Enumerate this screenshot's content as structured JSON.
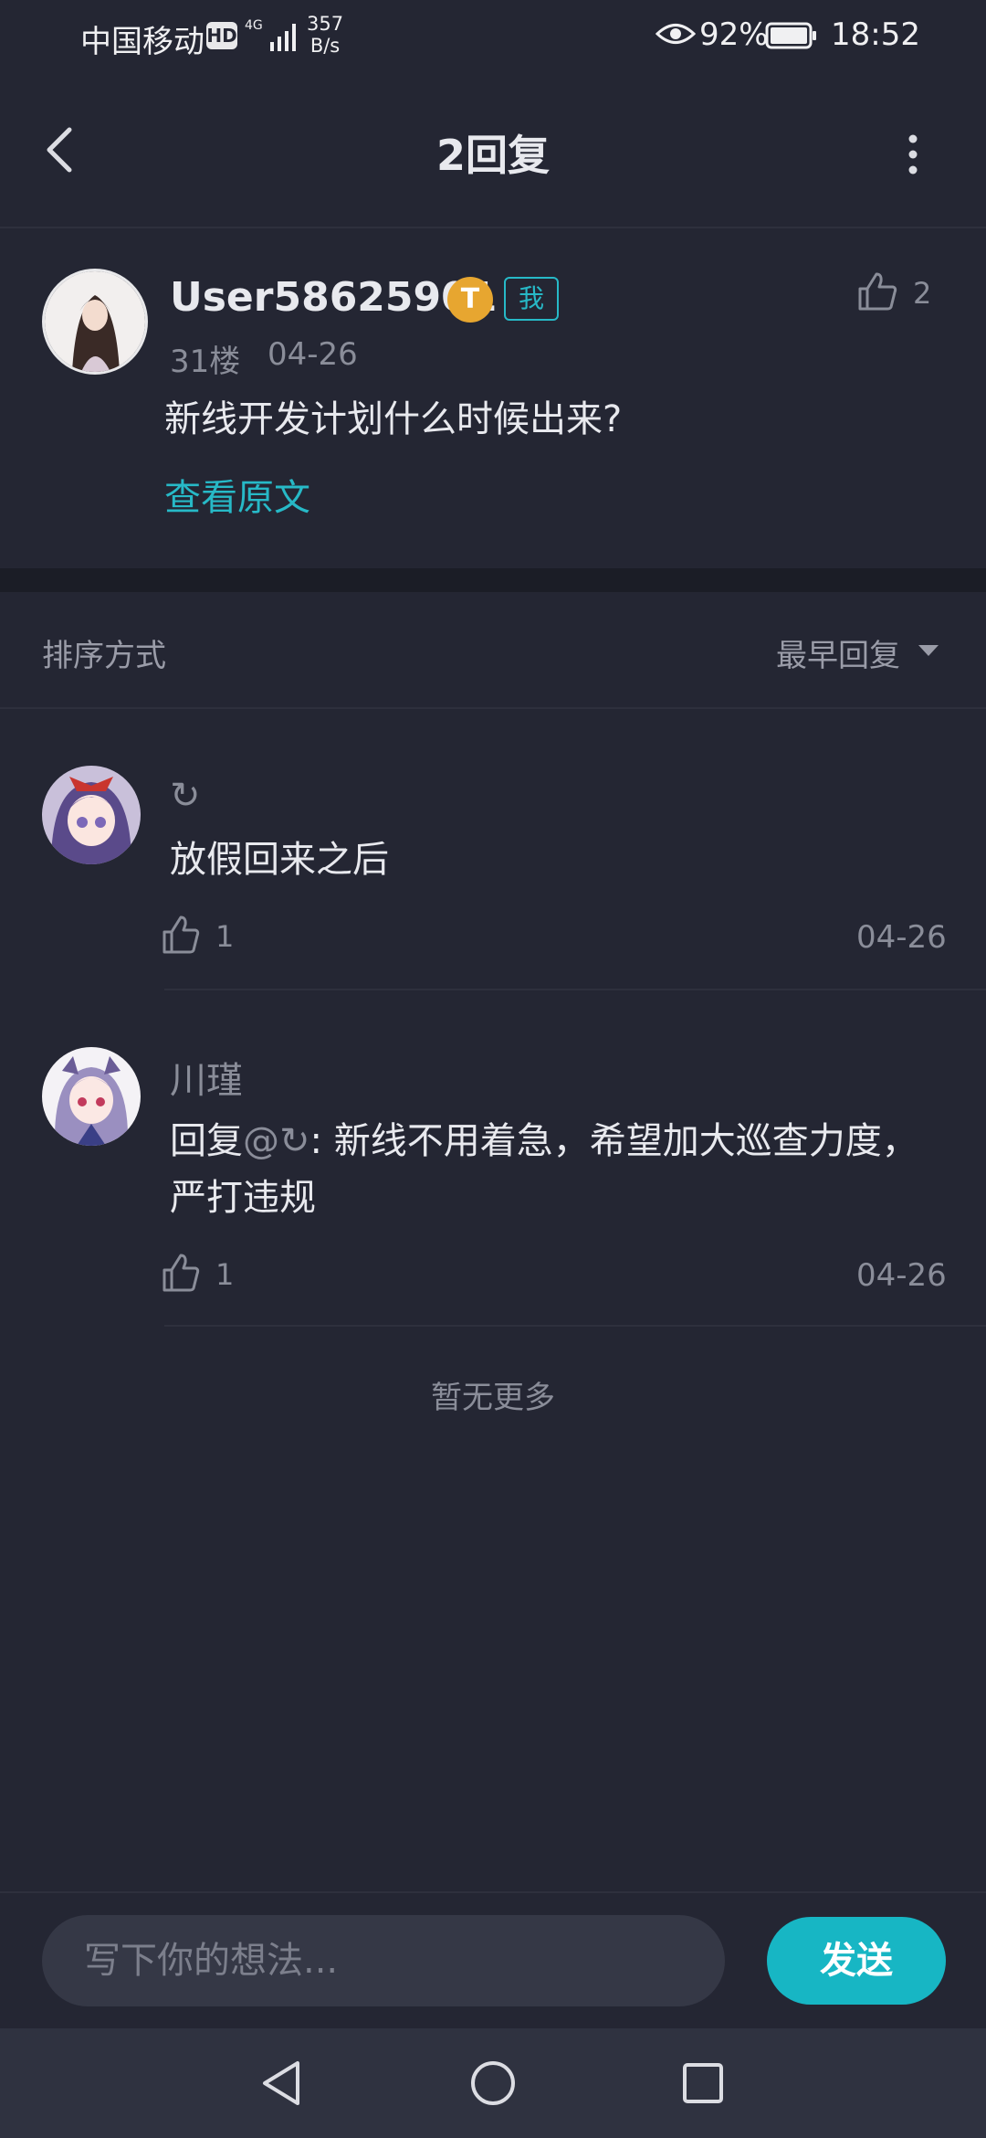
{
  "status_bar": {
    "carrier": "中国移动",
    "hd": "HD",
    "network": "4G",
    "speed_value": "357",
    "speed_unit": "B/s",
    "battery": "92%",
    "time": "18:52"
  },
  "header": {
    "title": "2回复"
  },
  "post": {
    "username": "User58625901",
    "badge_t": "T",
    "badge_me": "我",
    "likes": "2",
    "floor": "31楼",
    "date": "04-26",
    "text": "新线开发计划什么时候出来?",
    "view_original": "查看原文"
  },
  "sort": {
    "label": "排序方式",
    "value": "最早回复"
  },
  "replies": [
    {
      "name": "↻",
      "text": "放假回来之后",
      "likes": "1",
      "date": "04-26"
    },
    {
      "name": "川瑾",
      "text_prefix": "回复",
      "mention": "@↻",
      "text": ":  新线不用着急，希望加大巡查力度，严打违规",
      "likes": "1",
      "date": "04-26"
    }
  ],
  "no_more": "暂无更多",
  "composer": {
    "placeholder": "写下你的想法...",
    "send_label": "发送"
  },
  "colors": {
    "background": "#242633",
    "accent": "#27b9c7",
    "send_button": "#17b6c4",
    "badge_gold": "#e7a630"
  }
}
